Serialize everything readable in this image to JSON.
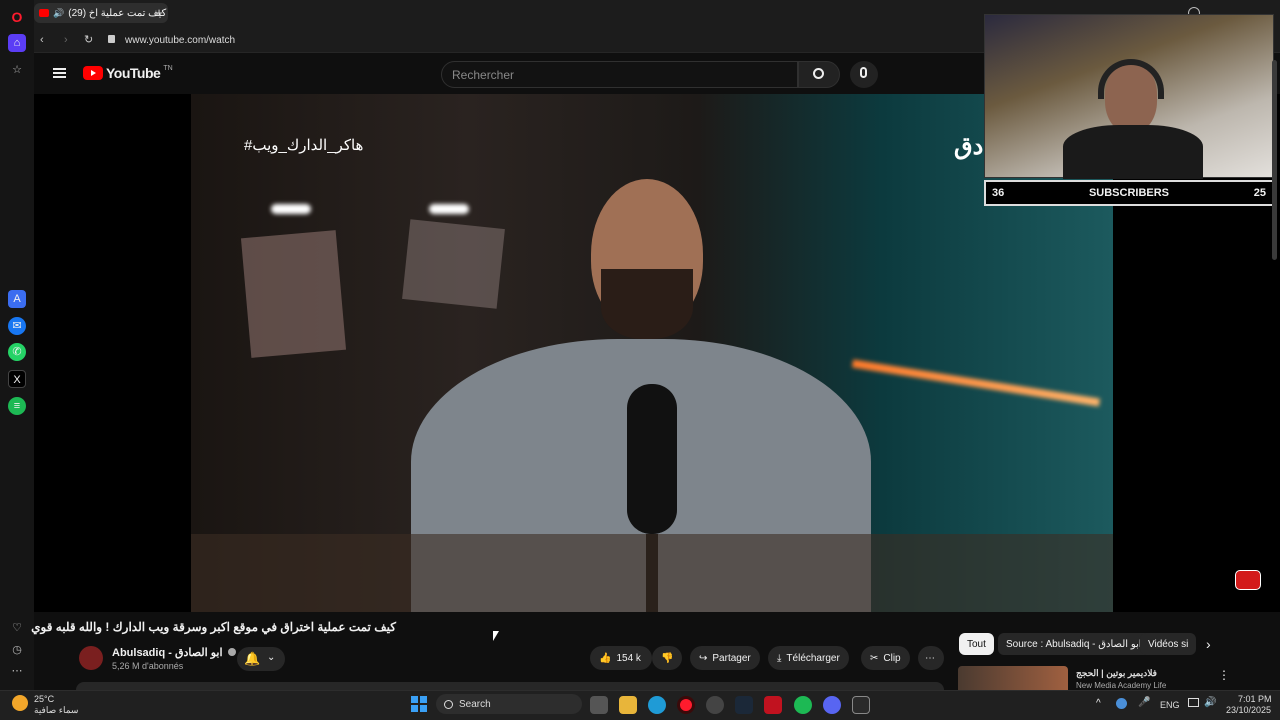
{
  "browser": {
    "tab_title": "كيف تمت عملية اخ (29)",
    "url": "www.youtube.com/watch"
  },
  "youtube": {
    "logo_text": "YouTube",
    "logo_sup": "TN",
    "search_placeholder": "Rechercher"
  },
  "video": {
    "overlay_hashtag": "#هاكر_الدارك_ويب",
    "overlay_right": "دق"
  },
  "webcam": {
    "left_count": "36",
    "label": "SUBSCRIBERS",
    "right_count": "25"
  },
  "details": {
    "title": "كيف تمت عملية اختراق في موقع اكبر وسرقة ويب الدارك ! والله قلبه قوي",
    "channel_name": "Abulsadiq - ابو الصادق",
    "subscribers": "5,26 M d'abonnés",
    "likes": "154 k",
    "share_label": "Partager",
    "download_label": "Télécharger",
    "clip_label": "Clip"
  },
  "chips": [
    "Tout",
    "Source : Abulsadiq - ابو الصادق",
    "Vidéos si"
  ],
  "recommendation": {
    "title": "فلاديمير بوتين | الحجج",
    "channel": "New Media Academy Life"
  },
  "taskbar": {
    "weather_temp": "25°C",
    "weather_desc": "سماء صافية",
    "search_label": "Search",
    "lang": "ENG",
    "time": "7:01 PM",
    "date": "23/10/2025"
  },
  "colors": {
    "accent_red": "#ff0000",
    "opera_red": "#ff1b2d"
  }
}
